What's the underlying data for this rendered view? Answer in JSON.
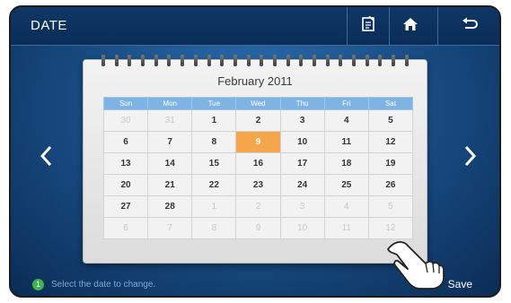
{
  "header": {
    "title": "DATE",
    "buttons": [
      {
        "name": "memo",
        "icon": "memo-icon"
      },
      {
        "name": "home",
        "icon": "home-icon"
      },
      {
        "name": "back",
        "icon": "back-arrow-icon"
      }
    ]
  },
  "calendar": {
    "month_title": "February 2011",
    "weekdays": [
      "Sun",
      "Mon",
      "Tue",
      "Wed",
      "Thu",
      "Fri",
      "Sat"
    ],
    "selected_day": "9",
    "weeks": [
      [
        {
          "d": "30",
          "o": true
        },
        {
          "d": "31",
          "o": true
        },
        {
          "d": "1"
        },
        {
          "d": "2"
        },
        {
          "d": "3"
        },
        {
          "d": "4"
        },
        {
          "d": "5"
        }
      ],
      [
        {
          "d": "6"
        },
        {
          "d": "7"
        },
        {
          "d": "8"
        },
        {
          "d": "9",
          "s": true
        },
        {
          "d": "10"
        },
        {
          "d": "11"
        },
        {
          "d": "12"
        }
      ],
      [
        {
          "d": "13"
        },
        {
          "d": "14"
        },
        {
          "d": "15"
        },
        {
          "d": "16"
        },
        {
          "d": "17"
        },
        {
          "d": "18"
        },
        {
          "d": "19"
        }
      ],
      [
        {
          "d": "20"
        },
        {
          "d": "21"
        },
        {
          "d": "22"
        },
        {
          "d": "23"
        },
        {
          "d": "24"
        },
        {
          "d": "25"
        },
        {
          "d": "26"
        }
      ],
      [
        {
          "d": "27"
        },
        {
          "d": "28"
        },
        {
          "d": "1",
          "o": true
        },
        {
          "d": "2",
          "o": true
        },
        {
          "d": "3",
          "o": true
        },
        {
          "d": "4",
          "o": true
        },
        {
          "d": "5",
          "o": true
        }
      ],
      [
        {
          "d": "6",
          "o": true
        },
        {
          "d": "7",
          "o": true
        },
        {
          "d": "8",
          "o": true
        },
        {
          "d": "9",
          "o": true
        },
        {
          "d": "10",
          "o": true
        },
        {
          "d": "11",
          "o": true
        },
        {
          "d": "12",
          "o": true
        }
      ]
    ]
  },
  "footer": {
    "step_number": "1",
    "hint": "Select the date to change.",
    "save_label": "Save"
  },
  "colors": {
    "header_bar": "#0d3261",
    "weekday_header": "#7fb3e3",
    "selected_day": "#f5a64b",
    "step_badge": "#3eb24b"
  }
}
